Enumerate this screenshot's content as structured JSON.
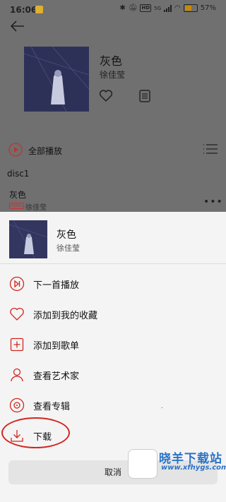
{
  "status_bar": {
    "time": "16:06",
    "battery": "57%",
    "network": "5G",
    "hd": "HD"
  },
  "header": {
    "back_icon": "arrow-left-icon"
  },
  "album": {
    "title": "灰色",
    "artist": "徐佳莹"
  },
  "toolbar": {
    "play_all": "全部播放"
  },
  "disc": {
    "label": "disc1"
  },
  "track": {
    "title": "灰色",
    "artist": "徐佳莹",
    "badge": "HiRes"
  },
  "sheet": {
    "title": "灰色",
    "artist": "徐佳莹",
    "items": [
      {
        "label": "下一首播放",
        "icon": "play-next-icon"
      },
      {
        "label": "添加到我的收藏",
        "icon": "heart-icon"
      },
      {
        "label": "添加到歌单",
        "icon": "add-to-playlist-icon"
      },
      {
        "label": "查看艺术家",
        "icon": "person-icon"
      },
      {
        "label": "查看专辑",
        "icon": "album-disc-icon"
      },
      {
        "label": "下载",
        "icon": "download-icon"
      }
    ],
    "cancel": "取消"
  },
  "watermark": {
    "text": "晓羊下载站",
    "url": "www.xfhygs.com"
  },
  "colors": {
    "accent": "#d2261f",
    "watermark": "#2a73c8"
  }
}
